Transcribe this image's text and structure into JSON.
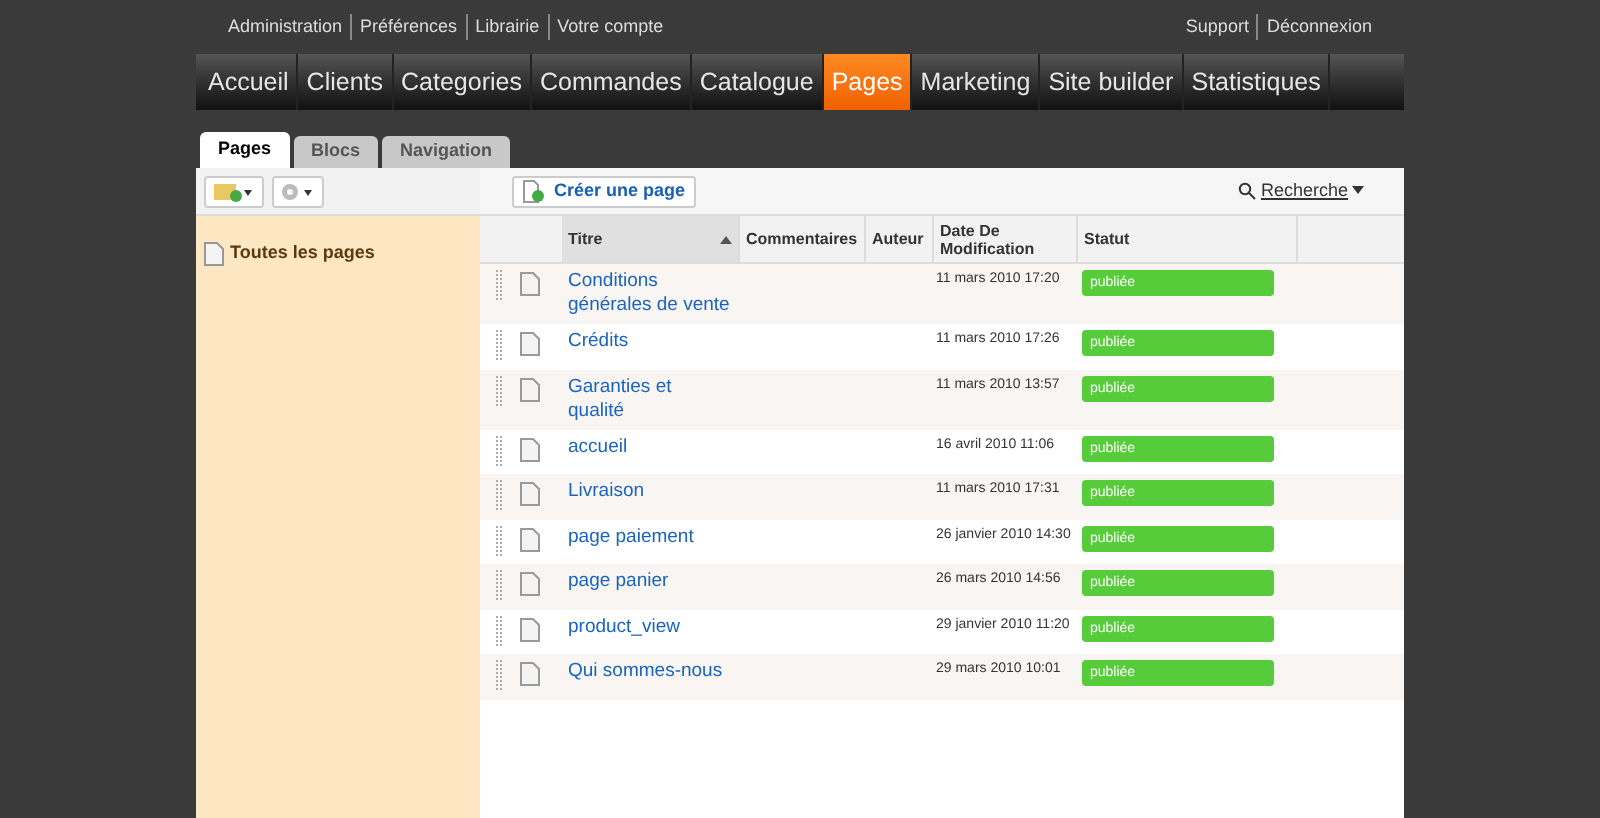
{
  "top_links": [
    "Administration",
    "Préférences",
    "Librairie",
    "Votre compte"
  ],
  "top_links_right": [
    "Support",
    "Déconnexion"
  ],
  "nav": [
    {
      "label": "Accueil",
      "selected": false
    },
    {
      "label": "Clients",
      "selected": false
    },
    {
      "label": "Categories",
      "selected": false
    },
    {
      "label": "Commandes",
      "selected": false
    },
    {
      "label": "Catalogue",
      "selected": false
    },
    {
      "label": "Pages",
      "selected": true
    },
    {
      "label": "Marketing",
      "selected": false
    },
    {
      "label": "Site builder",
      "selected": false
    },
    {
      "label": "Statistiques",
      "selected": false
    }
  ],
  "tabs": [
    {
      "label": "Pages",
      "selected": true
    },
    {
      "label": "Blocs",
      "selected": false
    },
    {
      "label": "Navigation",
      "selected": false
    }
  ],
  "sidebar": {
    "items": [
      "Toutes les pages"
    ]
  },
  "toolbar": {
    "create_button": "Créer une page",
    "search": "Recherche"
  },
  "table": {
    "columns": [
      "Titre",
      "Commentaires",
      "Auteur",
      "Date De Modification",
      "Statut"
    ],
    "rows": [
      {
        "title": "Conditions générales de vente",
        "date": "11 mars 2010 17:20",
        "status": "publiée"
      },
      {
        "title": "Crédits",
        "date": "11 mars 2010 17:26",
        "status": "publiée"
      },
      {
        "title": "Garanties et qualité",
        "date": "11 mars 2010 13:57",
        "status": "publiée"
      },
      {
        "title": "accueil",
        "date": "16 avril 2010 11:06",
        "status": "publiée"
      },
      {
        "title": "Livraison",
        "date": "11 mars 2010 17:31",
        "status": "publiée"
      },
      {
        "title": "page paiement",
        "date": "26 janvier 2010 14:30",
        "status": "publiée"
      },
      {
        "title": "page panier",
        "date": "26 mars 2010 14:56",
        "status": "publiée"
      },
      {
        "title": "product_view",
        "date": "29 janvier 2010 11:20",
        "status": "publiée"
      },
      {
        "title": "Qui sommes-nous",
        "date": "29 mars 2010 10:01",
        "status": "publiée"
      }
    ]
  }
}
